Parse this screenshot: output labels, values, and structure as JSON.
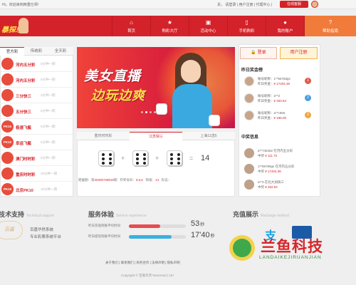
{
  "topbar": {
    "welcome": "Hi，欢迎来到西重仕师!",
    "links": "关，  请登录  | 用户注册 | 代理中心 |",
    "service_btn": "在线客服"
  },
  "logo": {
    "text": "暴探乐"
  },
  "nav": {
    "items": [
      {
        "label": "首页",
        "icon": "home-icon",
        "glyph": "⌂"
      },
      {
        "label": "购彩大厅",
        "icon": "star-icon",
        "glyph": "★"
      },
      {
        "label": "活动中心",
        "icon": "gift-icon",
        "glyph": "▣"
      },
      {
        "label": "手机购彩",
        "icon": "phone-icon",
        "glyph": "▯"
      },
      {
        "label": "我的账户",
        "icon": "user-icon",
        "glyph": "●"
      },
      {
        "label": "帮助指南",
        "icon": "help-icon",
        "glyph": "?"
      }
    ]
  },
  "lottery": {
    "tabs": [
      "官方彩",
      "传统彩",
      "全天彩"
    ],
    "items": [
      {
        "icon_text": "",
        "name": "河内五分彩",
        "time": "5分钟一期",
        "color": "#e84c3d"
      },
      {
        "icon_text": "",
        "name": "河内五分彩",
        "time": "5分钟一期",
        "color": "#e84c3d"
      },
      {
        "icon_text": "",
        "name": "三分快三",
        "time": "3分钟一期",
        "color": "#e84c3d"
      },
      {
        "icon_text": "",
        "name": "五分快三",
        "time": "5分钟一期",
        "color": "#e84c3d"
      },
      {
        "icon_text": "PK10",
        "name": "极速飞艇",
        "time": "5分钟一期",
        "color": "#e84c3d"
      },
      {
        "icon_text": "PK10",
        "name": "幸运飞艇",
        "time": "5分钟一期",
        "color": "#e84c3d"
      },
      {
        "icon_text": "",
        "name": "澳门时时彩",
        "time": "5分钟一期",
        "color": "#e84c3d"
      },
      {
        "icon_text": "",
        "name": "重庆时时彩",
        "time": "20分钟一期",
        "color": "#e84c3d"
      },
      {
        "icon_text": "PK10",
        "name": "北京PK10",
        "time": "20分钟一期",
        "color": "#e84c3d"
      }
    ]
  },
  "banner": {
    "line1": "美女直播",
    "line2": "边玩边爽",
    "slide_count": 5,
    "active_slide": 1
  },
  "draw": {
    "tabs": [
      "重庆时时彩",
      "江苏快三",
      "上海11选5"
    ],
    "active_tab": 1,
    "dice": [
      6,
      6,
      6
    ],
    "plus": "+",
    "equals": "=",
    "sum": "14",
    "info": {
      "issue_label": "距截期：第",
      "issue": "20200728015",
      "issue_suffix": "期",
      "numbers_label": "开奖号码：",
      "numbers": "3,5,6",
      "sum_label": "和值：",
      "sum": "14",
      "shape_label": "形态："
    }
  },
  "auth": {
    "login": "登录",
    "register": "用户注册"
  },
  "winners": {
    "title": "昨日奖金榜",
    "items": [
      {
        "account": "账号昵称：1**5678dgs",
        "prize_label": "昨日奖金：",
        "prize": "¥ 17404.36",
        "rank": "1",
        "rank_color": "#e05a47"
      },
      {
        "account": "账号昵称：a**3",
        "prize_label": "昨日奖金：",
        "prize": "¥ 262.84",
        "rank": "2",
        "rank_color": "#4a9de0"
      },
      {
        "account": "账号昵称：a**c666",
        "prize_label": "昨日奖金：",
        "prize": "¥ 196.00",
        "rank": "3",
        "rank_color": "#f0a63a"
      }
    ]
  },
  "news": {
    "title": "中奖信息",
    "items": [
      {
        "user": "a**745462",
        "game": "在河内五分彩",
        "prize_label": "中奖",
        "prize": "¥ 111.72"
      },
      {
        "user": "1**56789gs",
        "game": "在河内五分彩",
        "prize_label": "中奖",
        "prize": "¥ 17404.36"
      },
      {
        "user": "a**3",
        "game": "在北大加快三",
        "prize_label": "中奖",
        "prize": "¥ 262.84"
      }
    ]
  },
  "tech": {
    "title": "技术支持",
    "subtitle": "Technical support",
    "line1": "百嘉华然系统",
    "line2": "专业彩票系统平台",
    "logo": "百嘉"
  },
  "service": {
    "title": "服务体验",
    "subtitle": "Service experience",
    "rows": [
      {
        "label": "昨日充值到账平均时间",
        "value": "53",
        "unit": "秒",
        "fill": 0.55,
        "color": "#e84c50"
      },
      {
        "label": "昨日提现到账平均时间",
        "value": "17'40",
        "unit": "秒",
        "fill": 0.75,
        "color": "#3ab0e0"
      }
    ]
  },
  "recharge": {
    "title": "充值展示",
    "subtitle": "Recharge method"
  },
  "footer": {
    "links": "关于我们 | 联系我们 | 商务合作 | 法律声明 | 隐私声明",
    "copyright": "Copyright © 百嘉华然 Reserved | 18+"
  },
  "watermark": {
    "title": "兰鱼科技",
    "subtitle": "LANDAIKEJIRUANJIAN"
  }
}
